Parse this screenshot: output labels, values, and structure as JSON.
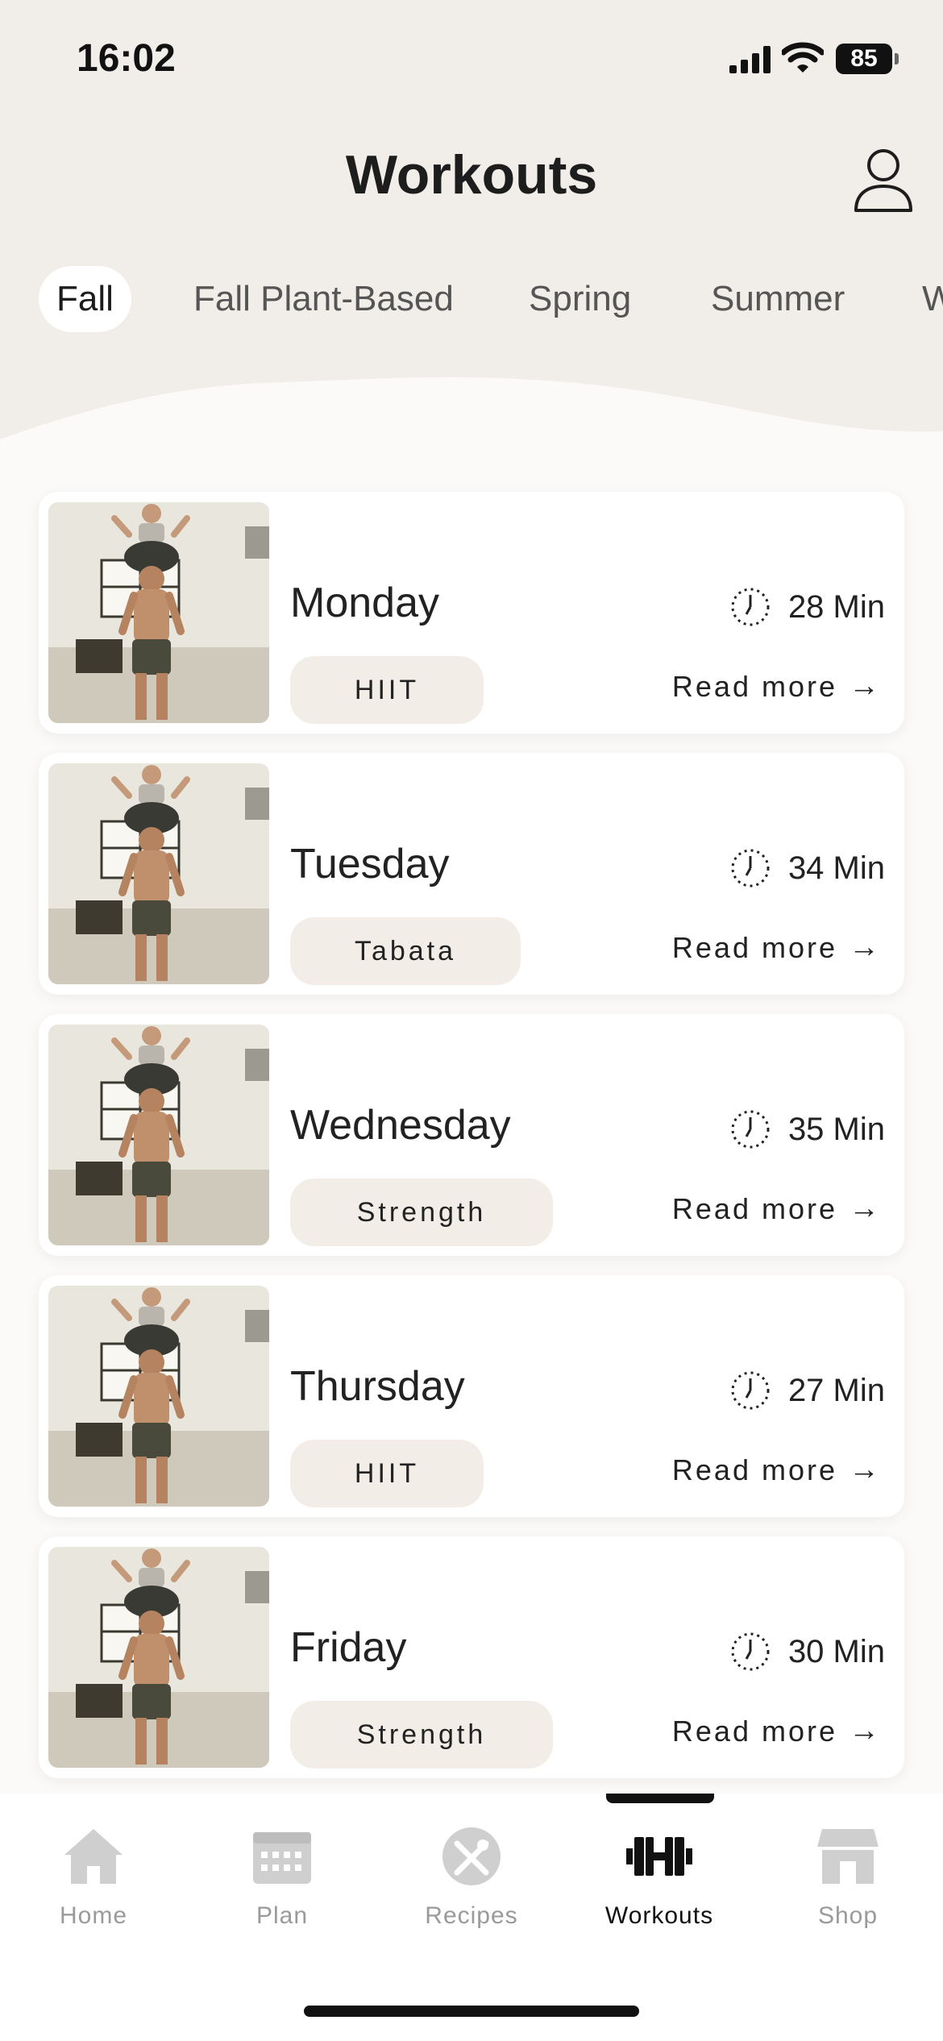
{
  "status_bar": {
    "time": "16:02",
    "battery": "85"
  },
  "header": {
    "title": "Workouts"
  },
  "tabs": [
    {
      "label": "Fall",
      "active": true
    },
    {
      "label": "Fall Plant-Based",
      "active": false
    },
    {
      "label": "Spring",
      "active": false
    },
    {
      "label": "Summer",
      "active": false
    },
    {
      "label": "W",
      "active": false
    }
  ],
  "workouts": [
    {
      "day": "Monday",
      "type": "HIIT",
      "duration": "28 Min",
      "read_more": "Read more"
    },
    {
      "day": "Tuesday",
      "type": "Tabata",
      "duration": "34 Min",
      "read_more": "Read more"
    },
    {
      "day": "Wednesday",
      "type": "Strength",
      "duration": "35 Min",
      "read_more": "Read more"
    },
    {
      "day": "Thursday",
      "type": "HIIT",
      "duration": "27 Min",
      "read_more": "Read more"
    },
    {
      "day": "Friday",
      "type": "Strength",
      "duration": "30 Min",
      "read_more": "Read more"
    }
  ],
  "tab_bar": [
    {
      "label": "Home",
      "icon": "home-icon",
      "active": false
    },
    {
      "label": "Plan",
      "icon": "calendar-icon",
      "active": false
    },
    {
      "label": "Recipes",
      "icon": "utensils-icon",
      "active": false
    },
    {
      "label": "Workouts",
      "icon": "dumbbell-icon",
      "active": true
    },
    {
      "label": "Shop",
      "icon": "store-icon",
      "active": false
    }
  ],
  "colors": {
    "header_bg": "#f1ede8",
    "chip_bg": "#f2ede6",
    "inactive_icon": "#cfcfcf"
  }
}
